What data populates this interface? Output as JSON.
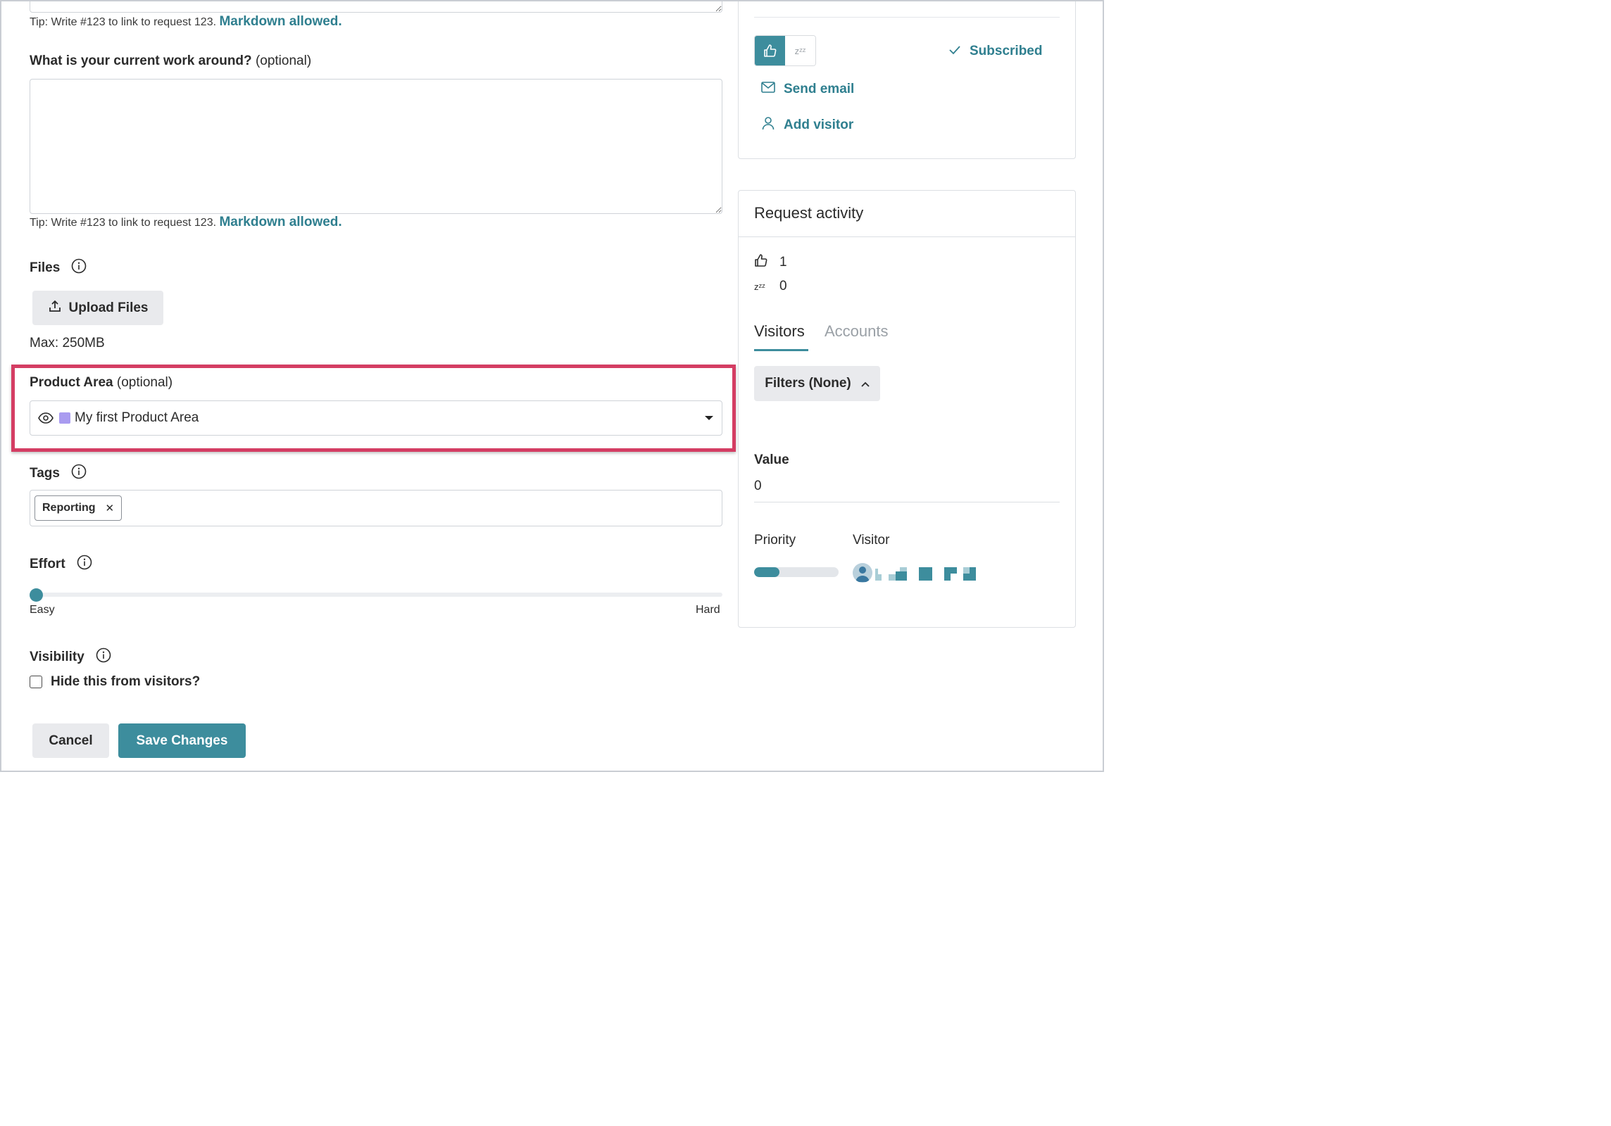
{
  "form": {
    "tip_text": "Tip: Write #123 to link to request 123.",
    "markdown_link": "Markdown allowed.",
    "workaround": {
      "label": "What is your current work around?",
      "optional": "(optional)",
      "value": ""
    },
    "files": {
      "label": "Files",
      "upload_label": "Upload Files",
      "max_text": "Max: 250MB"
    },
    "product_area": {
      "label": "Product Area",
      "optional": "(optional)",
      "selected": "My first Product Area",
      "swatch_color": "#a99bf0"
    },
    "tags": {
      "label": "Tags",
      "items": [
        "Reporting"
      ],
      "remove_glyph": "✕"
    },
    "effort": {
      "label": "Effort",
      "min_label": "Easy",
      "max_label": "Hard",
      "value": 0
    },
    "visibility": {
      "label": "Visibility",
      "checkbox_label": "Hide this from visitors?",
      "checked": false
    },
    "cancel_label": "Cancel",
    "save_label": "Save Changes"
  },
  "sidebar": {
    "subscribed_label": "Subscribed",
    "send_email_label": "Send email",
    "add_visitor_label": "Add visitor",
    "vote_zz_glyph": "zᶻᶻ"
  },
  "activity": {
    "title": "Request activity",
    "upvotes": "1",
    "snoozes": "0",
    "zz_glyph": "zᶻᶻ",
    "tabs": [
      "Visitors",
      "Accounts"
    ],
    "active_tab": "Visitors",
    "filters_label": "Filters (None)",
    "value_label": "Value",
    "value": "0",
    "priority_label": "Priority",
    "visitor_label": "Visitor",
    "priority_fraction": 0.3
  },
  "colors": {
    "accent": "#3d8d9d",
    "link": "#2f7f8f",
    "highlight": "#d43d63"
  }
}
